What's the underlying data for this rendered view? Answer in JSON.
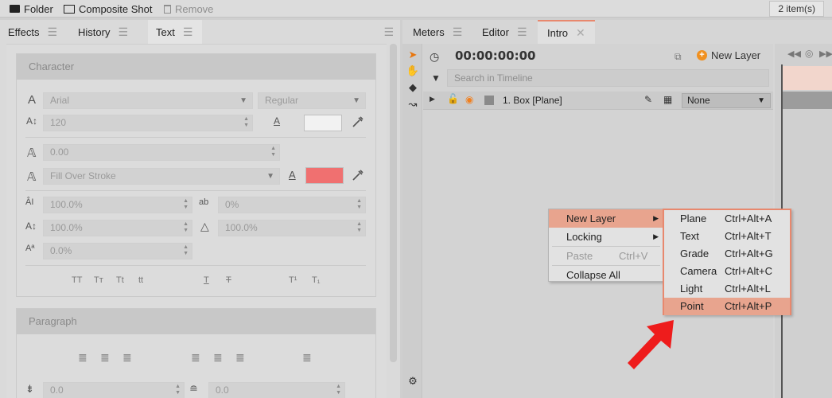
{
  "toolbar": {
    "folder": "Folder",
    "composite_shot": "Composite Shot",
    "remove": "Remove",
    "items_count": "2 item(s)"
  },
  "left_tabs": [
    {
      "label": "Effects"
    },
    {
      "label": "History"
    },
    {
      "label": "Text"
    }
  ],
  "character": {
    "title": "Character",
    "font": "Arial",
    "style": "Regular",
    "size": "120",
    "tracking": "0.00",
    "fill_mode": "Fill Over Stroke",
    "scale_v": "100.0%",
    "kerning": "0%",
    "scale_h": "100.0%",
    "slant": "100.0%",
    "baseline": "0.0%",
    "fill_color": "#f2f2f2",
    "stroke_color": "#f07070",
    "caps_buttons": [
      "TT",
      "Tт",
      "Tt",
      "tt"
    ],
    "underline_buttons": [
      "T",
      "T"
    ],
    "script_buttons": [
      "T¹",
      "T₁"
    ]
  },
  "paragraph": {
    "title": "Paragraph",
    "indent": "0.0",
    "spacing": "0.0"
  },
  "right_tabs": [
    {
      "label": "Meters"
    },
    {
      "label": "Editor"
    },
    {
      "label": "Intro"
    }
  ],
  "timeline": {
    "timecode": "00:00:00:00",
    "new_layer": "New Layer",
    "search_placeholder": "Search in Timeline",
    "layer_name": "1. Box [Plane]",
    "blend": "None"
  },
  "context_menu": [
    {
      "label": "New Layer",
      "shortcut": "",
      "arrow": "▶"
    },
    {
      "label": "Locking",
      "shortcut": "",
      "arrow": "▶"
    },
    {
      "label": "Paste",
      "shortcut": "Ctrl+V",
      "arrow": ""
    },
    {
      "label": "Collapse All",
      "shortcut": "",
      "arrow": ""
    }
  ],
  "submenu": [
    {
      "label": "Plane",
      "shortcut": "Ctrl+Alt+A"
    },
    {
      "label": "Text",
      "shortcut": "Ctrl+Alt+T"
    },
    {
      "label": "Grade",
      "shortcut": "Ctrl+Alt+G"
    },
    {
      "label": "Camera",
      "shortcut": "Ctrl+Alt+C"
    },
    {
      "label": "Light",
      "shortcut": "Ctrl+Alt+L"
    },
    {
      "label": "Point",
      "shortcut": "Ctrl+Alt+P"
    }
  ],
  "colors": {
    "accent": "#e8886e",
    "highlight": "#e8a48e",
    "arrow": "#ee1c1c"
  }
}
